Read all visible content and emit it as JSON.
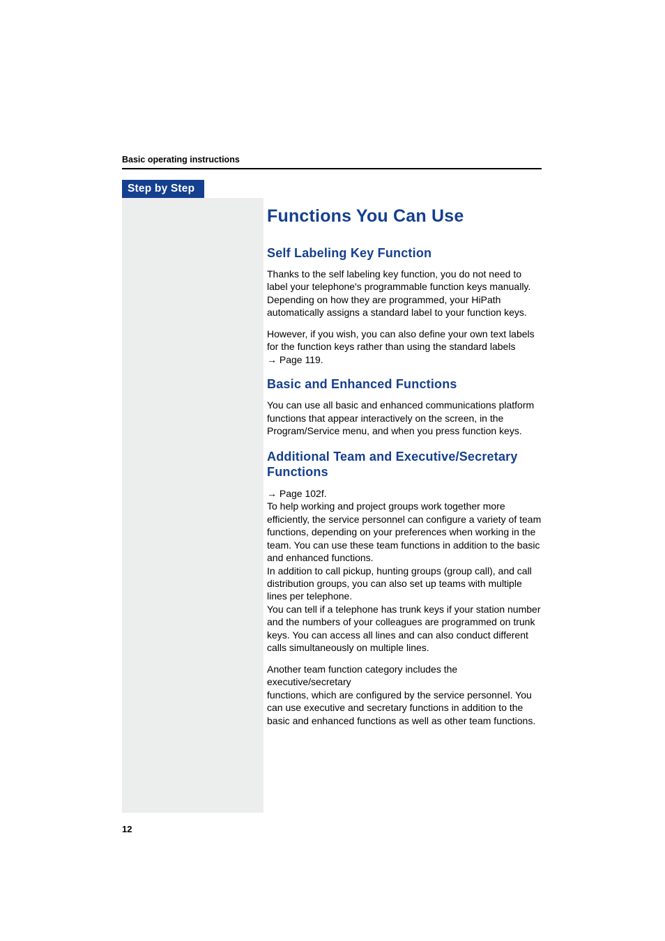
{
  "header": {
    "title": "Basic operating instructions"
  },
  "sidebar": {
    "badge": "Step by Step"
  },
  "content": {
    "h1": "Functions You Can Use",
    "section1": {
      "heading": "Self Labeling Key Function",
      "p1": "Thanks to the self labeling key function, you do not need to label your telephone's programmable function keys manually. Depending on how they are programmed, your HiPath automatically assigns a standard label to your function keys.",
      "p2a": "However, if you wish, you can also define your own text labels for the function keys rather than using the standard labels ",
      "p2_ref_arrow": "→",
      "p2_ref": " Page 119.",
      "p2b": ""
    },
    "section2": {
      "heading": "Basic and Enhanced Functions",
      "p1": "You can use all basic and enhanced communications platform functions that appear interactively on the screen, in the Program/Service menu, and when you press function keys."
    },
    "section3": {
      "heading": "Additional Team and Executive/Secretary Functions",
      "p1_ref_arrow": "→",
      "p1_ref": " Page 102f.",
      "p1a": "To help working and project groups work together more efficiently, the service personnel can configure a variety of team functions, depending on your preferences when working in the team. You can use these team functions in addition to the basic and enhanced functions.",
      "p1b": "In addition to call pickup, hunting groups (group call), and call distribution groups, you can also set up teams with multiple lines per telephone.",
      "p1c": "You can tell if a telephone has trunk keys if your station number and the numbers of your colleagues are programmed on trunk keys. You can access all lines and can also conduct different calls simultaneously on multiple lines.",
      "p2a": "Another team function category includes the executive/secretary",
      "p2b": "functions, which are configured by the service personnel. You can use executive and secretary functions in addition to the basic and enhanced functions as well as other team functions."
    }
  },
  "footer": {
    "page_number": "12"
  }
}
